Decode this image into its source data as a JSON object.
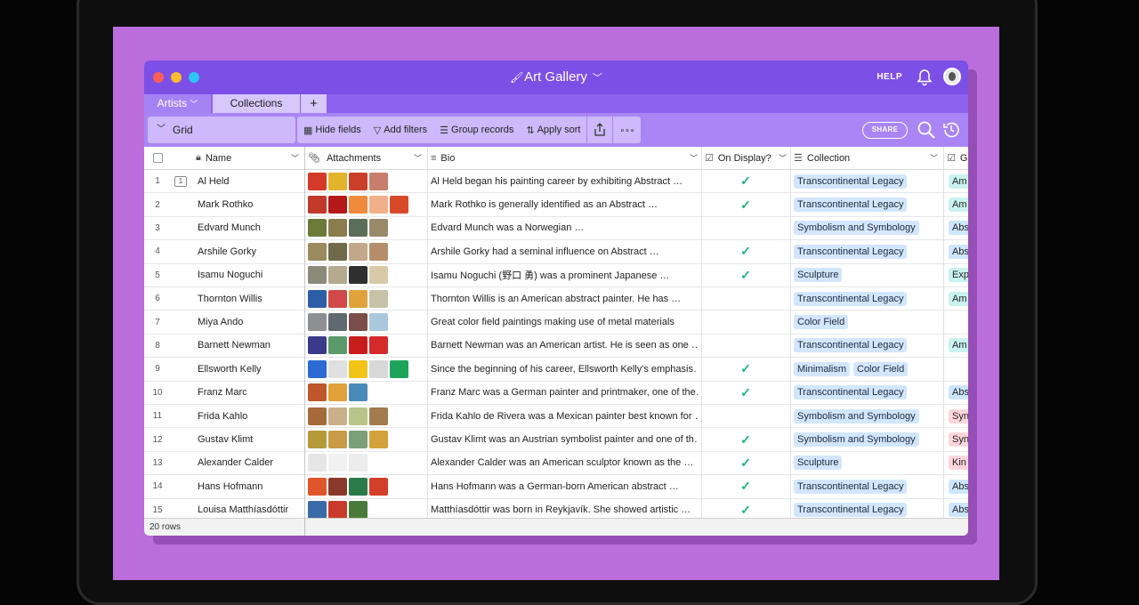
{
  "window": {
    "title": "Art Gallery",
    "help_label": "HELP"
  },
  "tabs": [
    {
      "label": "Artists",
      "active": true
    },
    {
      "label": "Collections",
      "active": false
    },
    {
      "label": "+"
    }
  ],
  "toolbar": {
    "view_name": "Grid",
    "hide_fields": "Hide fields",
    "add_filters": "Add filters",
    "group_records": "Group records",
    "apply_sort": "Apply sort",
    "more": "∘∘∘",
    "share": "SHARE"
  },
  "columns": {
    "name": "Name",
    "attachments": "Attachments",
    "bio": "Bio",
    "on_display": "On Display?",
    "collection": "Collection",
    "g": "G"
  },
  "rows": [
    {
      "num": "1",
      "comments": "1",
      "name": "Al Held",
      "bio": "Al Held began his painting career by exhibiting Abstract …",
      "on_display": true,
      "collection": [
        "Transcontinental Legacy"
      ],
      "g": "Am",
      "thumbs": [
        "#d33a2a",
        "#e2b42c",
        "#c93f2a",
        "#c87e6c"
      ]
    },
    {
      "num": "2",
      "comments": "",
      "name": "Mark Rothko",
      "bio": "Mark Rothko is generally identified as an Abstract …",
      "on_display": true,
      "collection": [
        "Transcontinental Legacy"
      ],
      "g": "Am",
      "thumbs": [
        "#c0392b",
        "#b51818",
        "#f08a3c",
        "#f2b08a",
        "#d8492a"
      ]
    },
    {
      "num": "3",
      "comments": "",
      "name": "Edvard Munch",
      "bio": "Edvard Munch was a Norwegian …",
      "on_display": false,
      "collection": [
        "Symbolism and Symbology"
      ],
      "g": "Abs",
      "thumbs": [
        "#6c7a3a",
        "#8a7c4c",
        "#5b6e5a",
        "#9a8a6a"
      ]
    },
    {
      "num": "4",
      "comments": "",
      "name": "Arshile Gorky",
      "bio": "Arshile Gorky had a seminal influence on Abstract …",
      "on_display": true,
      "collection": [
        "Transcontinental Legacy"
      ],
      "g": "Abs",
      "thumbs": [
        "#9b8a5e",
        "#6f6a4a",
        "#c2a78a",
        "#b48e6a"
      ]
    },
    {
      "num": "5",
      "comments": "",
      "name": "Isamu Noguchi",
      "bio": "Isamu Noguchi (野口 勇) was a prominent Japanese …",
      "on_display": true,
      "collection": [
        "Sculpture"
      ],
      "g": "Exp",
      "thumbs": [
        "#8b8b7a",
        "#b5a98e",
        "#2f2f2f",
        "#d9c9a8"
      ]
    },
    {
      "num": "6",
      "comments": "",
      "name": "Thornton Willis",
      "bio": "Thornton Willis is an American abstract painter. He has …",
      "on_display": false,
      "collection": [
        "Transcontinental Legacy"
      ],
      "g": "Am",
      "thumbs": [
        "#2c5ea8",
        "#d04a4a",
        "#e0a23a",
        "#c7c2a8"
      ]
    },
    {
      "num": "7",
      "comments": "",
      "name": "Miya Ando",
      "bio": "Great color field paintings making use of metal materials",
      "on_display": false,
      "collection": [
        "Color Field"
      ],
      "g": "",
      "thumbs": [
        "#8d8f92",
        "#5f6a6f",
        "#7a4e4a",
        "#a9c8dc"
      ]
    },
    {
      "num": "8",
      "comments": "",
      "name": "Barnett Newman",
      "bio": "Barnett Newman was an American artist. He is seen as one …",
      "on_display": false,
      "collection": [
        "Transcontinental Legacy"
      ],
      "g": "Am",
      "thumbs": [
        "#3a3a8a",
        "#5a9a6a",
        "#c81d1d",
        "#d42a2a"
      ]
    },
    {
      "num": "9",
      "comments": "",
      "name": "Ellsworth Kelly",
      "bio": "Since the beginning of his career, Ellsworth Kelly's emphasis…",
      "on_display": true,
      "collection": [
        "Minimalism",
        "Color Field"
      ],
      "g": "",
      "thumbs": [
        "#2d6ad4",
        "#e0e0e0",
        "#f2c418",
        "#d8d8d8",
        "#1ea45a"
      ]
    },
    {
      "num": "10",
      "comments": "",
      "name": "Franz Marc",
      "bio": "Franz Marc was a German painter and printmaker, one of the…",
      "on_display": true,
      "collection": [
        "Transcontinental Legacy"
      ],
      "g": "Abs",
      "thumbs": [
        "#c0572a",
        "#e2a23a",
        "#4a8ab8"
      ]
    },
    {
      "num": "11",
      "comments": "",
      "name": "Frida Kahlo",
      "bio": "Frida Kahlo de Rivera was a Mexican painter best known for …",
      "on_display": false,
      "collection": [
        "Symbolism and Symbology"
      ],
      "g": "Syn",
      "thumbs": [
        "#a66a3a",
        "#c9b08a",
        "#b8c48a",
        "#a27b4e"
      ]
    },
    {
      "num": "12",
      "comments": "",
      "name": "Gustav Klimt",
      "bio": "Gustav Klimt was an Austrian symbolist painter and one of th…",
      "on_display": true,
      "collection": [
        "Symbolism and Symbology"
      ],
      "g": "Syn",
      "thumbs": [
        "#b59a3a",
        "#c99b46",
        "#7aa07a",
        "#d4a23a"
      ]
    },
    {
      "num": "13",
      "comments": "",
      "name": "Alexander Calder",
      "bio": "Alexander Calder was an American sculptor known as the …",
      "on_display": true,
      "collection": [
        "Sculpture"
      ],
      "g": "Kin",
      "thumbs": [
        "#e6e6e6",
        "#f1f1f1",
        "#ececec"
      ]
    },
    {
      "num": "14",
      "comments": "",
      "name": "Hans Hofmann",
      "bio": "Hans Hofmann was a German-born American abstract …",
      "on_display": true,
      "collection": [
        "Transcontinental Legacy"
      ],
      "g": "Abs",
      "thumbs": [
        "#e0562a",
        "#8a3a2a",
        "#2a7a4a",
        "#d2402a"
      ]
    },
    {
      "num": "15",
      "comments": "",
      "name": "Louisa Matthíasdóttir",
      "bio": "Matthíasdóttir was born in Reykjavík. She showed artistic …",
      "on_display": true,
      "collection": [
        "Transcontinental Legacy"
      ],
      "g": "Abs",
      "thumbs": [
        "#3a6aa8",
        "#c83a2a",
        "#4a7a3a"
      ]
    }
  ],
  "g_colors": {
    "Am": "#c9f3ee",
    "Abs": "#cde6ff",
    "Exp": "#c9f3ee",
    "Syn": "#ffd6dc",
    "Kin": "#ffd6dc"
  },
  "footer": {
    "row_count": "20 rows"
  },
  "colors": {
    "titlebar": "#7c4fe6",
    "toolbar": "#a985f6",
    "check": "#20b27a",
    "pill": "#d2e6ff"
  }
}
